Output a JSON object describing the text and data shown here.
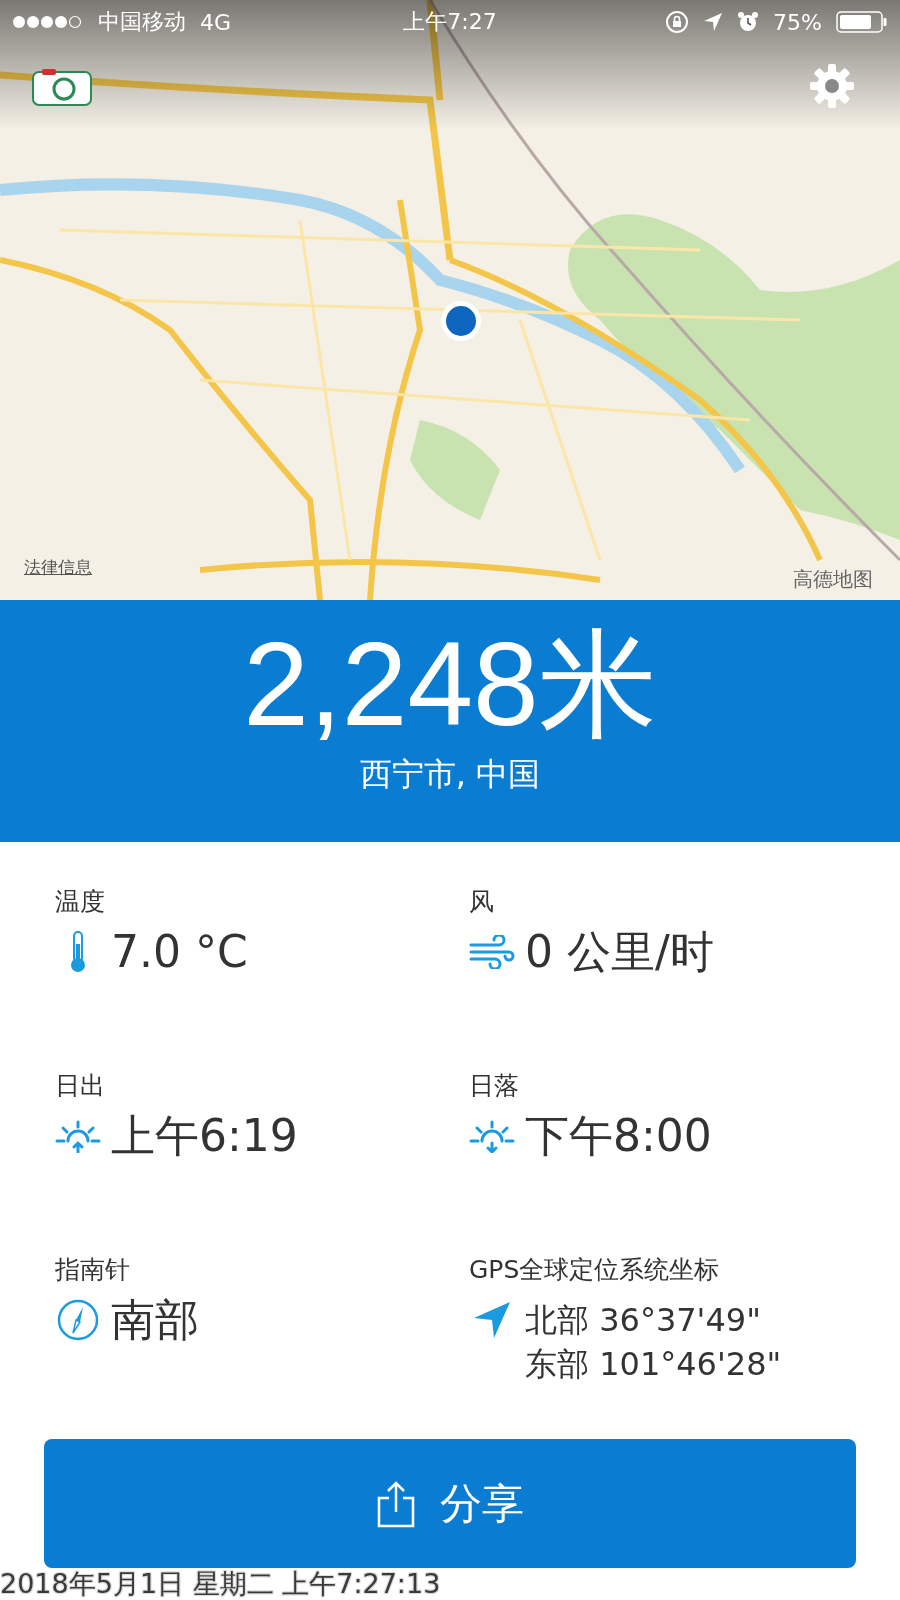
{
  "status_bar": {
    "carrier": "中国移动",
    "network": "4G",
    "time": "上午7:27",
    "battery_percent": "75%"
  },
  "map": {
    "kind": "picture",
    "legal_link": "法律信息",
    "attribution": "高德地图"
  },
  "altitude": {
    "value": "2,248米",
    "location": "西宁市, 中国"
  },
  "stats": [
    {
      "kind": "temperature",
      "label": "温度",
      "lines": [
        "7.0 °C"
      ]
    },
    {
      "kind": "wind",
      "label": "风",
      "lines": [
        "0 公里/时"
      ]
    },
    {
      "kind": "sunrise",
      "label": "日出",
      "lines": [
        "上午6:19"
      ]
    },
    {
      "kind": "sunset",
      "label": "日落",
      "lines": [
        "下午8:00"
      ]
    },
    {
      "kind": "compass",
      "label": "指南针",
      "lines": [
        "南部"
      ]
    },
    {
      "kind": "gps",
      "label": "GPS全球定位系统坐标",
      "lines": [
        "北部 36°37'49\"",
        "东部 101°46'28\""
      ]
    }
  ],
  "share_button": {
    "label": "分享"
  },
  "timestamp": "2018年5月1日 星期二 上午7:27:13"
}
